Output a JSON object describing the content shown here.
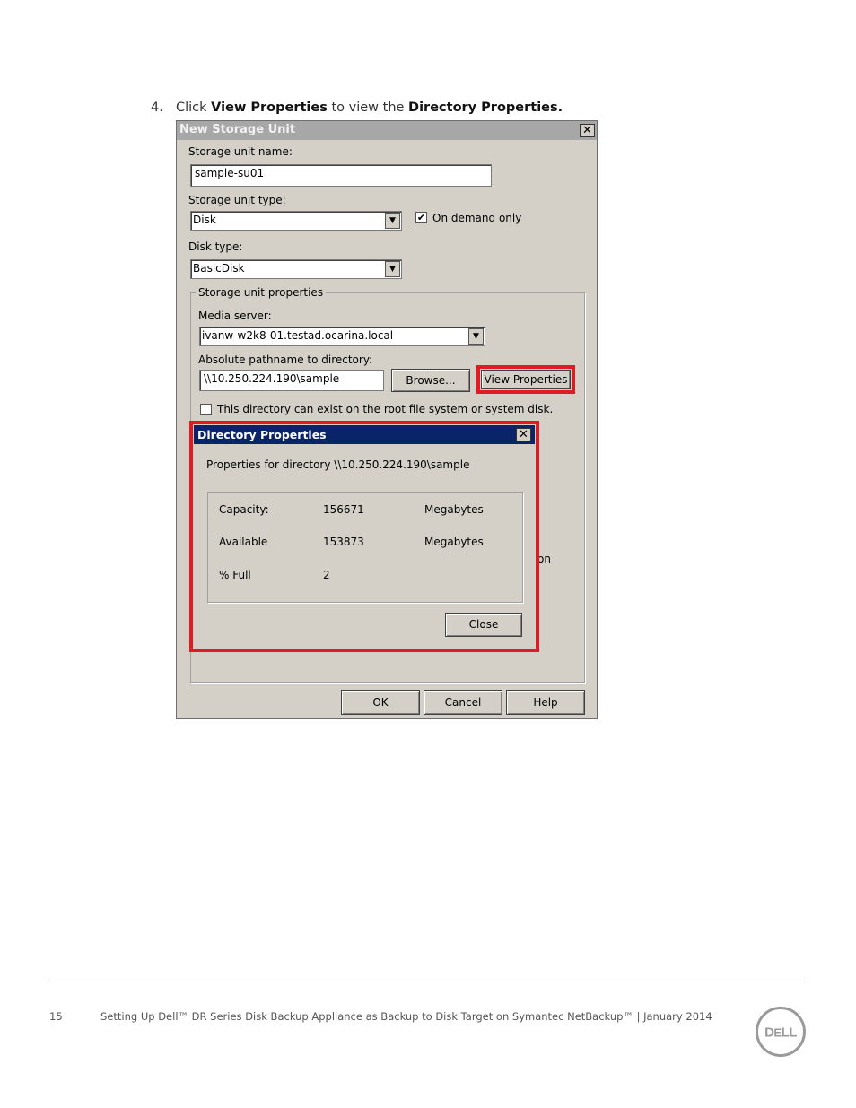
{
  "instruction": {
    "number": "4.",
    "pre": "Click",
    "bold1": "View Properties",
    "mid": "to view the",
    "bold2": "Directory Properties."
  },
  "dialog": {
    "title": "New Storage Unit",
    "close_glyph": "✕",
    "storage_unit_name_label": "Storage unit name:",
    "storage_unit_name_value": "sample-su01",
    "storage_unit_type_label": "Storage unit type:",
    "storage_unit_type_value": "Disk",
    "on_demand_label": "On demand only",
    "on_demand_checked": "✔",
    "disk_type_label": "Disk type:",
    "disk_type_value": "BasicDisk",
    "group_label": "Storage unit properties",
    "media_server_label": "Media server:",
    "media_server_value": "ivanw-w2k8-01.testad.ocarina.local",
    "path_label": "Absolute pathname to directory:",
    "path_value": "\\\\10.250.224.190\\sample",
    "browse_label": "Browse...",
    "view_properties_label": "View Properties",
    "root_fs_label": "This directory can exist on the root file system or system disk.",
    "partial_text": "on",
    "ok_label": "OK",
    "cancel_label": "Cancel",
    "help_label": "Help",
    "dropdown_glyph": "▼"
  },
  "directory_properties": {
    "title": "Directory Properties",
    "close_glyph": "✕",
    "heading": "Properties for directory \\\\10.250.224.190\\sample",
    "rows": [
      {
        "label": "Capacity:",
        "value": "156671",
        "unit": "Megabytes"
      },
      {
        "label": "Available",
        "value": "153873",
        "unit": "Megabytes"
      },
      {
        "label": "% Full",
        "value": "2",
        "unit": ""
      }
    ],
    "close_label": "Close"
  },
  "footer": {
    "page_number": "15",
    "text": "Setting Up Dell™ DR Series Disk Backup Appliance as Backup to Disk Target on Symantec NetBackup™ | January 2014",
    "logo_text": "DELL"
  },
  "colors": {
    "highlight_red": "#e21b23",
    "dialog_gray": "#d4d0c8",
    "titlebar_blue": "#0a246a"
  }
}
